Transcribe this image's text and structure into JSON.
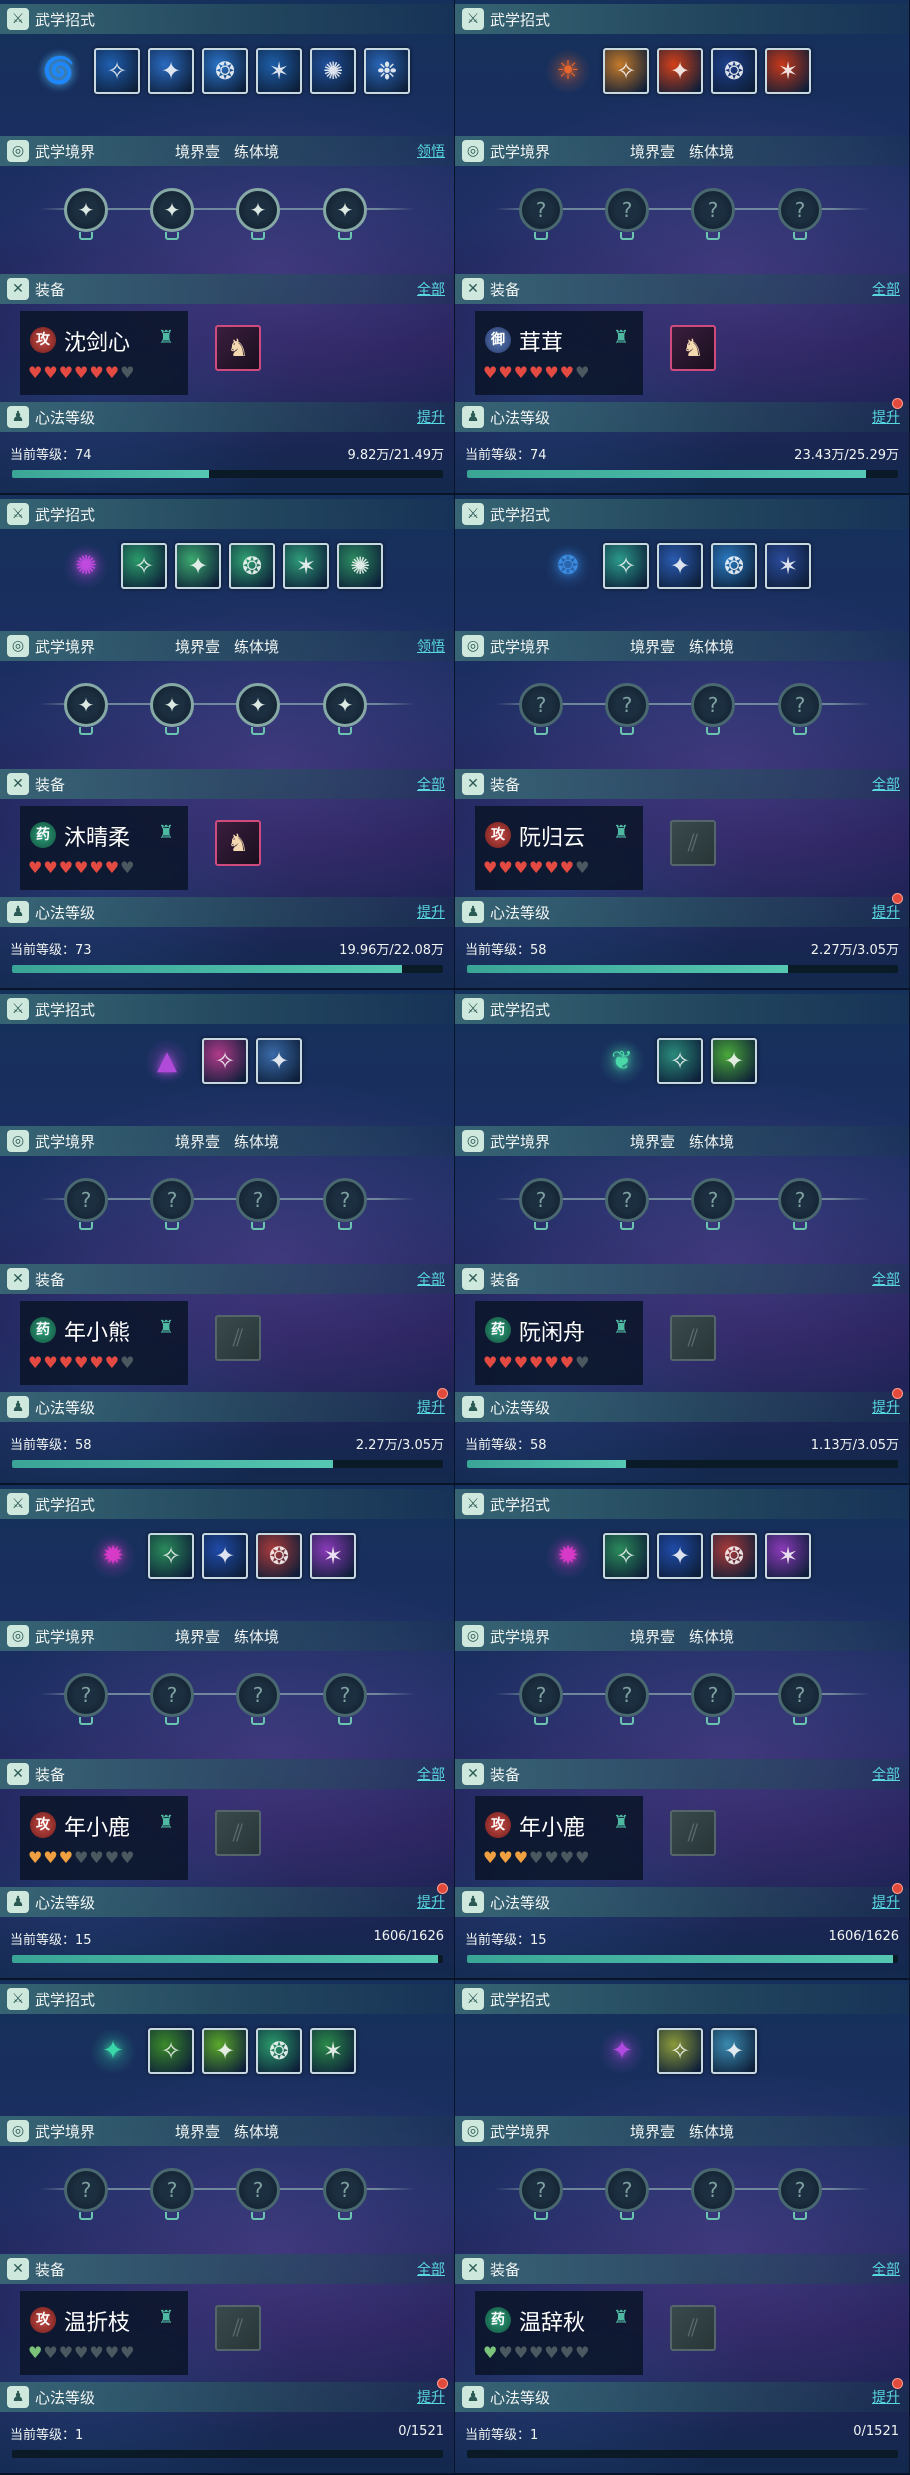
{
  "colors": {
    "link": "#58d8e0",
    "xp_fill": "#46b8a4",
    "heart_full": "#e24a42",
    "heart_gold": "#f0a040",
    "heart_empty": "#4b5860",
    "badge_dot": "#e24a3c"
  },
  "sections": {
    "skills_title": "武学招式",
    "realm_title": "武学境界",
    "equip_title": "装备",
    "heart_title": "心法等级",
    "realm_stage": "境界壹",
    "realm_form": "练体境",
    "realm_action": "领悟",
    "equip_action": "全部",
    "heart_action": "提升",
    "level_prefix": "当前等级："
  },
  "characters": [
    {
      "name": "沈剑心",
      "faction": "攻",
      "faction_type": "atk",
      "level": "74",
      "progress_text": "9.82万/21.49万",
      "progress": 0.457,
      "hearts": [
        "full",
        "full",
        "full",
        "full",
        "full",
        "full",
        "empty"
      ],
      "main_skill_icon": "water-vortex-icon",
      "main_skill_color": "#4aa8e8",
      "skills": [
        "#1f5fb0",
        "#2a6ac0",
        "#2a73c8",
        "#1d5ea8",
        "#1f4f9a",
        "#2a66b8"
      ],
      "realm_nodes": [
        "lit",
        "lit",
        "lit",
        "lit"
      ],
      "realm_can_learn": true,
      "gear": "armor-icon",
      "gear_empty": false,
      "red_dot": false
    },
    {
      "name": "茸茸",
      "faction": "御",
      "faction_type": "def",
      "level": "74",
      "progress_text": "23.43万/25.29万",
      "progress": 0.926,
      "hearts": [
        "full",
        "full",
        "full",
        "full",
        "full",
        "full",
        "empty"
      ],
      "main_skill_icon": "flame-figure-icon",
      "main_skill_color": "#e8662a",
      "skills": [
        "#c47a2a",
        "#d2401a",
        "#1d3f8a",
        "#c6381a"
      ],
      "realm_nodes": [
        "dim",
        "dim",
        "dim",
        "dim"
      ],
      "realm_can_learn": false,
      "gear": "armor-icon",
      "gear_empty": false,
      "red_dot": true
    },
    {
      "name": "沐晴柔",
      "faction": "药",
      "faction_type": "med",
      "level": "73",
      "progress_text": "19.96万/22.08万",
      "progress": 0.904,
      "hearts": [
        "full",
        "full",
        "full",
        "full",
        "full",
        "full",
        "empty"
      ],
      "main_skill_icon": "octopus-icon",
      "main_skill_color": "#c04ae0",
      "skills": [
        "#2a9a6a",
        "#3aa86e",
        "#2fa072",
        "#2e9a78",
        "#2a8a60"
      ],
      "realm_nodes": [
        "lit",
        "lit",
        "lit",
        "lit"
      ],
      "realm_can_learn": true,
      "gear": "armor-icon",
      "gear_empty": false,
      "red_dot": false
    },
    {
      "name": "阮归云",
      "faction": "攻",
      "faction_type": "atk",
      "level": "58",
      "progress_text": "2.27万/3.05万",
      "progress": 0.744,
      "hearts": [
        "full",
        "full",
        "full",
        "full",
        "full",
        "full",
        "empty"
      ],
      "main_skill_icon": "blue-wisp-icon",
      "main_skill_color": "#3a8ae0",
      "skills": [
        "#2a9a8a",
        "#2a5ab0",
        "#2a7ac0",
        "#2a4a9a"
      ],
      "realm_nodes": [
        "dim",
        "dim",
        "dim",
        "dim"
      ],
      "realm_can_learn": false,
      "gear": "empty-slot-icon",
      "gear_empty": true,
      "red_dot": true
    },
    {
      "name": "年小熊",
      "faction": "药",
      "faction_type": "med",
      "level": "58",
      "progress_text": "2.27万/3.05万",
      "progress": 0.744,
      "hearts": [
        "full",
        "full",
        "full",
        "full",
        "full",
        "full",
        "empty"
      ],
      "main_skill_icon": "crystal-cone-icon",
      "main_skill_color": "#b04ad8",
      "skills": [
        "#b03a8a",
        "#3a6aa8"
      ],
      "realm_nodes": [
        "dim",
        "dim",
        "dim",
        "dim"
      ],
      "realm_can_learn": false,
      "gear": "empty-slot-icon",
      "gear_empty": true,
      "red_dot": true
    },
    {
      "name": "阮闲舟",
      "faction": "药",
      "faction_type": "med",
      "level": "58",
      "progress_text": "1.13万/3.05万",
      "progress": 0.37,
      "hearts": [
        "full",
        "full",
        "full",
        "full",
        "full",
        "full",
        "empty"
      ],
      "main_skill_icon": "leaf-spirit-icon",
      "main_skill_color": "#4ad8a8",
      "skills": [
        "#2a8a7a",
        "#4aa83a"
      ],
      "realm_nodes": [
        "dim",
        "dim",
        "dim",
        "dim"
      ],
      "realm_can_learn": false,
      "gear": "empty-slot-icon",
      "gear_empty": true,
      "red_dot": true
    },
    {
      "name": "年小鹿",
      "faction": "攻",
      "faction_type": "atk",
      "level": "15",
      "progress_text": "1606/1626",
      "progress": 0.988,
      "hearts": [
        "gold",
        "gold",
        "gold",
        "empty",
        "empty",
        "empty",
        "empty"
      ],
      "main_skill_icon": "magenta-orb-icon",
      "main_skill_color": "#d83ac8",
      "skills": [
        "#2a8a5a",
        "#1f4aa8",
        "#a83a3a",
        "#8a3ab8"
      ],
      "realm_nodes": [
        "dim",
        "dim",
        "dim",
        "dim"
      ],
      "realm_can_learn": false,
      "gear": "empty-slot-icon",
      "gear_empty": true,
      "red_dot": true
    },
    {
      "name": "年小鹿",
      "faction": "攻",
      "faction_type": "atk",
      "level": "15",
      "progress_text": "1606/1626",
      "progress": 0.988,
      "hearts": [
        "gold",
        "gold",
        "gold",
        "empty",
        "empty",
        "empty",
        "empty"
      ],
      "main_skill_icon": "magenta-orb-icon",
      "main_skill_color": "#d83ac8",
      "skills": [
        "#2a8a5a",
        "#1f4aa8",
        "#a83a3a",
        "#8a3ab8"
      ],
      "realm_nodes": [
        "dim",
        "dim",
        "dim",
        "dim"
      ],
      "realm_can_learn": false,
      "gear": "empty-slot-icon",
      "gear_empty": true,
      "red_dot": true
    },
    {
      "name": "温折枝",
      "faction": "攻",
      "faction_type": "atk",
      "level": "1",
      "progress_text": "0/1521",
      "progress": 0,
      "hearts": [
        "half-green",
        "empty",
        "empty",
        "empty",
        "empty",
        "empty",
        "empty"
      ],
      "main_skill_icon": "green-claw-icon",
      "main_skill_color": "#3ad8a8",
      "skills": [
        "#3a8a2a",
        "#5aa82a",
        "#2a9a6a",
        "#2a8a4a"
      ],
      "realm_nodes": [
        "dim",
        "dim",
        "dim",
        "dim"
      ],
      "realm_can_learn": false,
      "gear": "empty-slot-icon",
      "gear_empty": true,
      "red_dot": true
    },
    {
      "name": "温辞秋",
      "faction": "药",
      "faction_type": "med",
      "level": "1",
      "progress_text": "0/1521",
      "progress": 0,
      "hearts": [
        "half-green",
        "empty",
        "empty",
        "empty",
        "empty",
        "empty",
        "empty"
      ],
      "main_skill_icon": "violet-claw-icon",
      "main_skill_color": "#b04ae0",
      "skills": [
        "#8a9a3a",
        "#3a8ab0"
      ],
      "realm_nodes": [
        "dim",
        "dim",
        "dim",
        "dim"
      ],
      "realm_can_learn": false,
      "gear": "empty-slot-icon",
      "gear_empty": true,
      "red_dot": true
    }
  ]
}
